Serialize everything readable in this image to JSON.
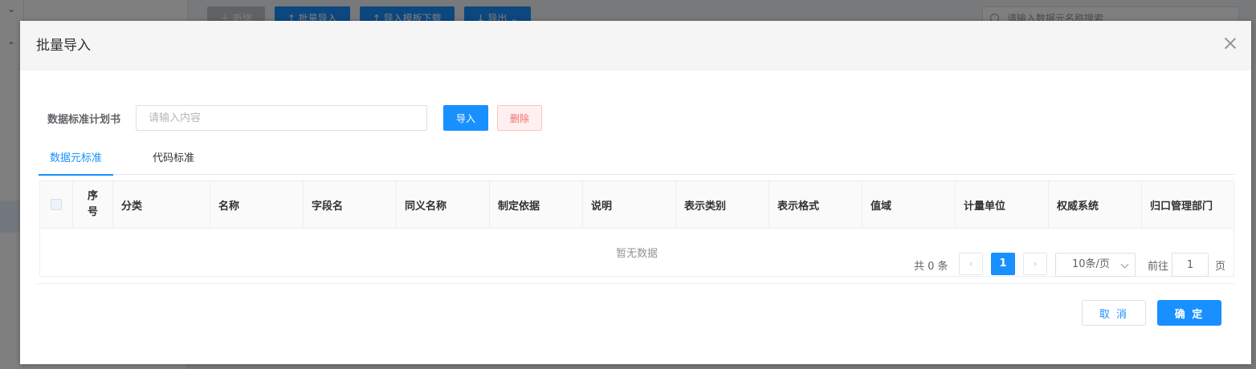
{
  "background": {
    "toolbar": [
      {
        "label": "新增",
        "icon": "plus-icon"
      },
      {
        "label": "批量导入",
        "icon": "upload-icon"
      },
      {
        "label": "导入模板下载",
        "icon": "upload-icon"
      },
      {
        "label": "导出",
        "icon": "download-icon"
      }
    ],
    "search_placeholder": "请输入数据元名称搜索"
  },
  "dialog": {
    "title": "批量导入",
    "form": {
      "label": "数据标准计划书",
      "input_placeholder": "请输入内容",
      "input_value": "",
      "import_label": "导入",
      "delete_label": "删除"
    },
    "tabs": [
      {
        "label": "数据元标准",
        "active": true
      },
      {
        "label": "代码标准",
        "active": false
      }
    ],
    "table": {
      "columns": [
        "序号",
        "分类",
        "名称",
        "字段名",
        "同义名称",
        "制定依据",
        "说明",
        "表示类别",
        "表示格式",
        "值域",
        "计量单位",
        "权威系统",
        "归口管理部门"
      ],
      "seq_label_top": "序",
      "seq_label_bottom": "号",
      "rows": [],
      "empty_text": "暂无数据"
    },
    "pagination": {
      "total_text": "共 0 条",
      "current_page": "1",
      "prev_glyph": "‹",
      "next_glyph": "›",
      "page_size": "10条/页",
      "goto_prefix": "前往",
      "goto_value": "1",
      "goto_suffix": "页"
    },
    "footer": {
      "cancel_label": "取 消",
      "ok_label": "确 定"
    }
  },
  "colors": {
    "primary": "#1890ff",
    "danger": "#f56c6c",
    "header_bg": "#f5f5f5"
  }
}
